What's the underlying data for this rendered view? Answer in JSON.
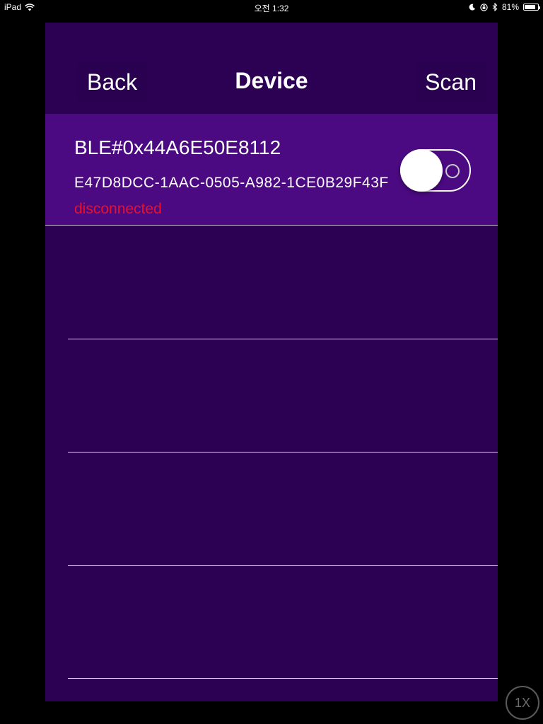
{
  "status_bar": {
    "device": "iPad",
    "time": "오전 1:32",
    "battery_percent": "81%",
    "battery_level": 0.81
  },
  "nav": {
    "back_label": "Back",
    "title": "Device",
    "scan_label": "Scan"
  },
  "devices": [
    {
      "name": "BLE#0x44A6E50E8112",
      "uuid": "E47D8DCC-1AAC-0505-A982-1CE0B29F43F",
      "status": "disconnected",
      "connected": false
    }
  ],
  "zoom_label": "1X",
  "colors": {
    "background": "#2c0053",
    "row_highlight": "#4b0a82",
    "status_disconnected": "#e8102a"
  }
}
